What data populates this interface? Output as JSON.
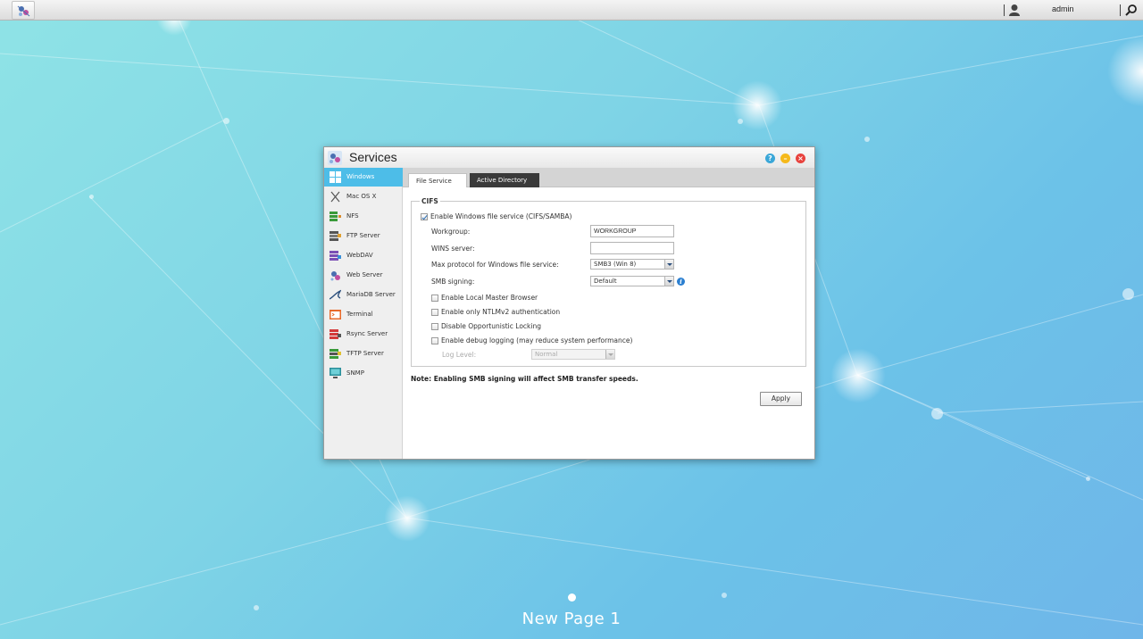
{
  "topbar": {
    "username": "admin"
  },
  "window": {
    "title": "Services"
  },
  "sidebar": {
    "items": [
      {
        "label": "Windows",
        "icon": "windows-icon"
      },
      {
        "label": "Mac OS X",
        "icon": "mac-os-x-icon"
      },
      {
        "label": "NFS",
        "icon": "nfs-icon"
      },
      {
        "label": "FTP Server",
        "icon": "ftp-server-icon"
      },
      {
        "label": "WebDAV",
        "icon": "webdav-icon"
      },
      {
        "label": "Web Server",
        "icon": "web-server-icon"
      },
      {
        "label": "MariaDB Server",
        "icon": "mariadb-server-icon"
      },
      {
        "label": "Terminal",
        "icon": "terminal-icon"
      },
      {
        "label": "Rsync Server",
        "icon": "rsync-server-icon"
      },
      {
        "label": "TFTP Server",
        "icon": "tftp-server-icon"
      },
      {
        "label": "SNMP",
        "icon": "snmp-icon"
      }
    ]
  },
  "tabs": {
    "file_service": "File Service",
    "active_directory": "Active Directory"
  },
  "cifs": {
    "legend": "CIFS",
    "enable_label": "Enable Windows file service (CIFS/SAMBA)",
    "workgroup_label": "Workgroup:",
    "workgroup_value": "WORKGROUP",
    "wins_label": "WINS server:",
    "wins_value": "",
    "max_protocol_label": "Max protocol for Windows file service:",
    "max_protocol_value": "SMB3 (Win 8)",
    "smb_signing_label": "SMB signing:",
    "smb_signing_value": "Default",
    "local_master_label": "Enable Local Master Browser",
    "ntlmv2_label": "Enable only NTLMv2 authentication",
    "oplocks_label": "Disable Opportunistic Locking",
    "debug_label": "Enable debug logging (may reduce system performance)",
    "log_level_label": "Log Level:",
    "log_level_value": "Normal"
  },
  "note": "Note: Enabling SMB signing will affect SMB transfer speeds.",
  "apply_label": "Apply",
  "desktop": {
    "page_label": "New Page 1"
  },
  "colors": {
    "accent": "#4dbde8",
    "tab_inactive": "#3a3a3a",
    "close": "#e8423d",
    "minimize": "#f5b91b",
    "help": "#3aa7d8"
  }
}
